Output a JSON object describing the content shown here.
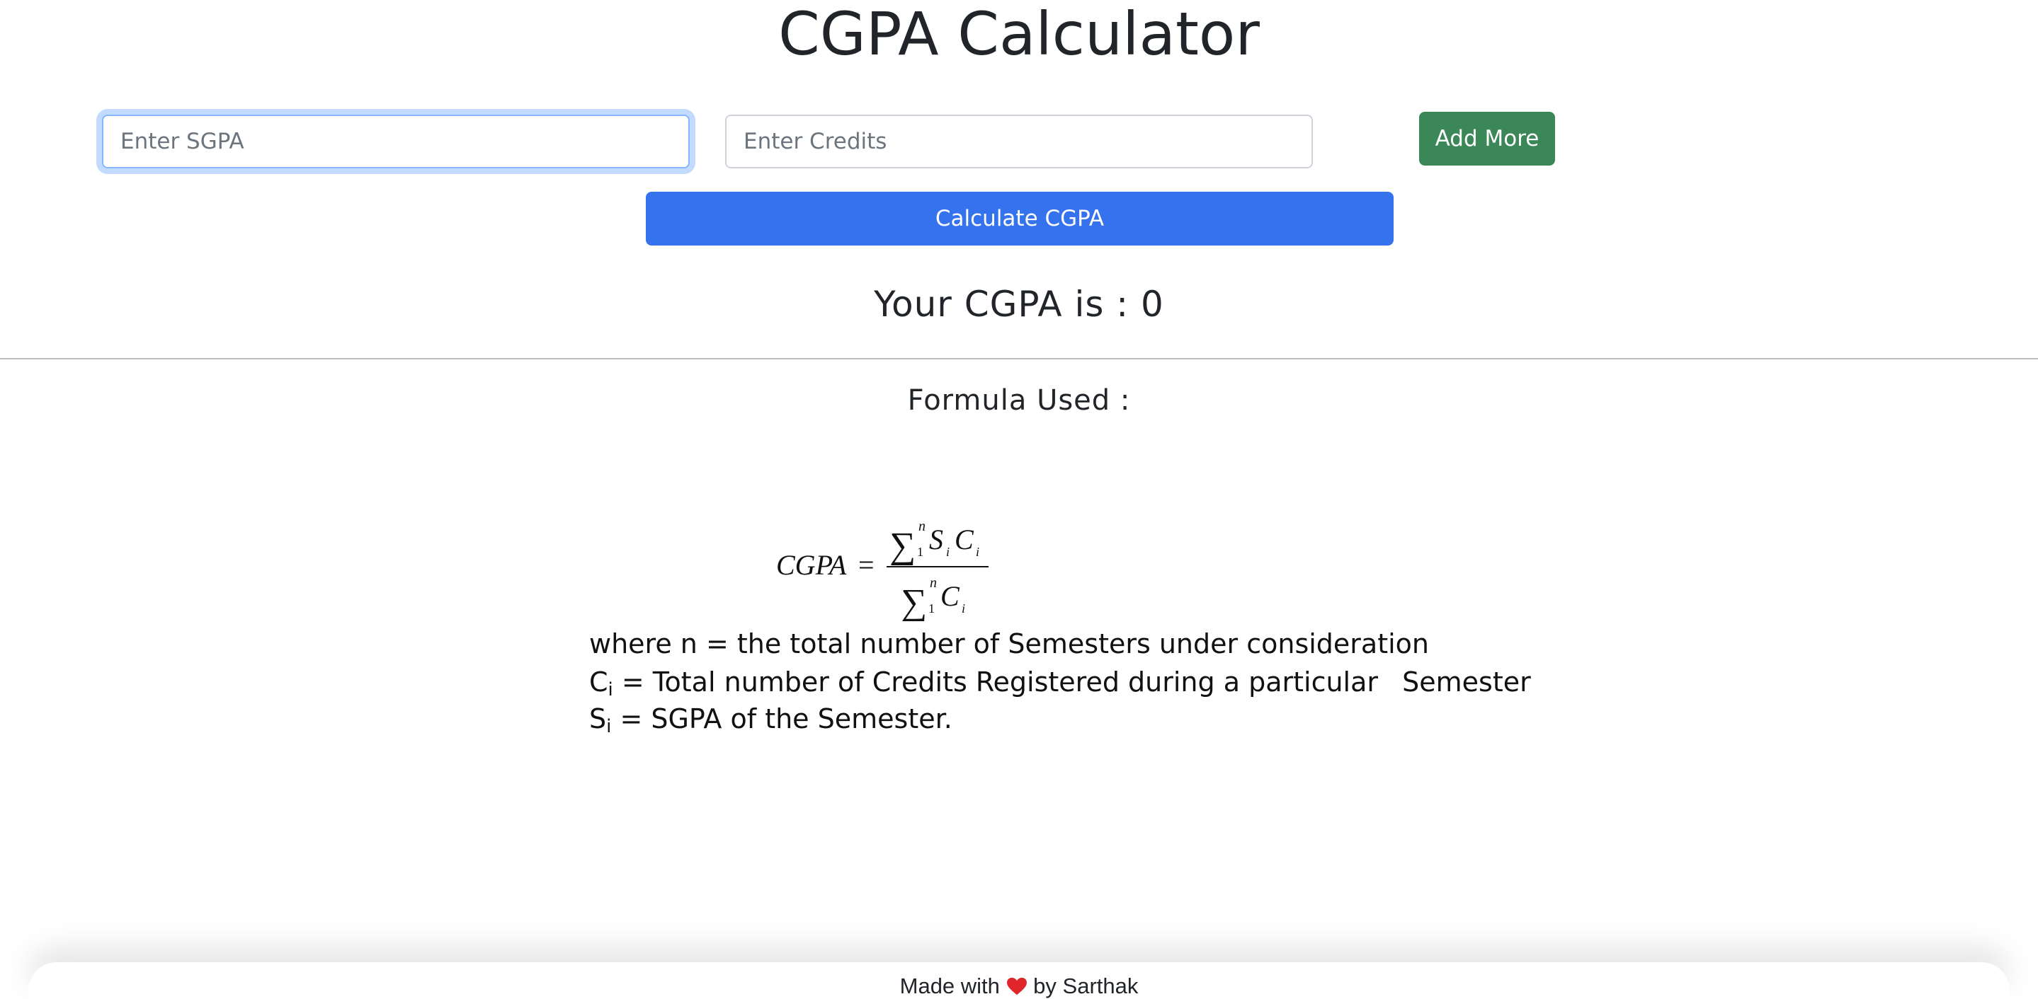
{
  "page": {
    "title": "CGPA Calculator"
  },
  "form": {
    "sgpa_placeholder": "Enter SGPA",
    "sgpa_value": "",
    "credits_placeholder": "Enter Credits",
    "credits_value": "",
    "add_more_label": "Add More",
    "calculate_label": "Calculate CGPA"
  },
  "result": {
    "prefix": "Your CGPA is : ",
    "value": "0"
  },
  "formula": {
    "heading": "Formula Used :",
    "lhs": "CGPA",
    "equals": "=",
    "sum_symbol": "∑",
    "upper_limit": "n",
    "lower_limit": "1",
    "numerator_s": "S",
    "numerator_c": "C",
    "denominator_c": "C",
    "index": "i"
  },
  "explanation": {
    "line1": "where n = the total number of Semesters under consideration",
    "line2_symbol": "C",
    "line2_sub": "i",
    "line2_text": " = Total number of Credits Registered during a particular",
    "line2_tail": "Semester",
    "line3_symbol": "S",
    "line3_sub": "i",
    "line3_text": " = SGPA of the Semester."
  },
  "footer": {
    "made_with": "Made with",
    "heart_icon": "heart-icon",
    "heart_color": "#e0262b",
    "by_text": "by Sarthak"
  },
  "colors": {
    "add_button": "#3b8757",
    "calculate_button": "#3572ee",
    "focus_border": "#86b7fe"
  }
}
